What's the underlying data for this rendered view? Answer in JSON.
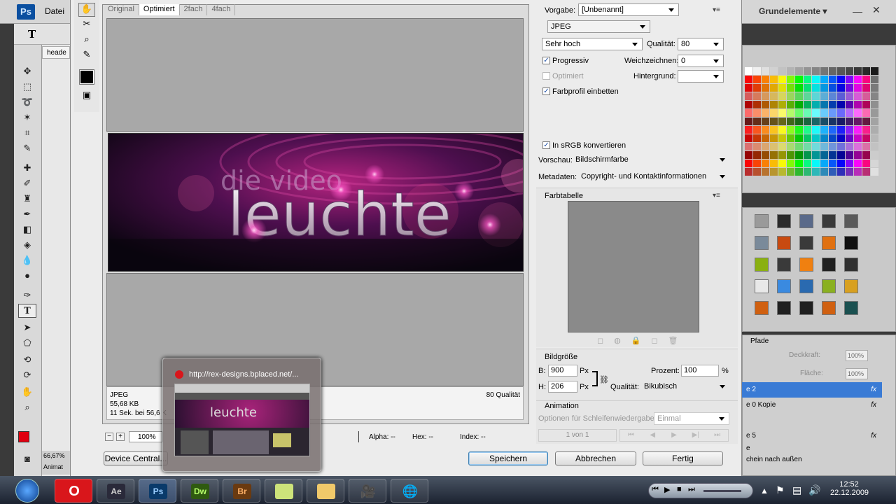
{
  "app": {
    "logo": "Ps",
    "menu_file": "Datei",
    "workspace": "Grundelemente"
  },
  "ps_tools": {
    "type_tool": "T",
    "doc_tab": "heade",
    "zoom_status": "66,67%",
    "anim_tab": "Animat"
  },
  "preview": {
    "tabs": [
      "Original",
      "Optimiert",
      "2fach",
      "4fach"
    ],
    "active_tab": "Optimiert",
    "banner_top_text": "die video",
    "banner_main_text": "leuchte",
    "info_format": "JPEG",
    "info_size": "55,68 KB",
    "info_time": "11 Sek. bei 56,6 K",
    "info_quality": "80 Qualität",
    "zoom": "100%",
    "alpha": "Alpha: --",
    "hex": "Hex: --",
    "index": "Index: --",
    "device_button": "Device Central..."
  },
  "settings": {
    "vorgabe_label": "Vorgabe:",
    "vorgabe_value": "[Unbenannt]",
    "format": "JPEG",
    "quality_preset": "Sehr hoch",
    "quality_label": "Qualität:",
    "quality_value": "80",
    "progressiv": "Progressiv",
    "weichzeichnen_label": "Weichzeichnen:",
    "weichzeichnen_value": "0",
    "optimiert": "Optimiert",
    "hintergrund_label": "Hintergrund:",
    "farbprofil": "Farbprofil einbetten",
    "srgb": "In sRGB konvertieren",
    "vorschau_label": "Vorschau:",
    "vorschau_value": "Bildschirmfarbe",
    "metadaten_label": "Metadaten:",
    "metadaten_value": "Copyright- und Kontaktinformationen",
    "farbtabelle": "Farbtabelle",
    "bildgroesse": "Bildgröße",
    "b_label": "B:",
    "b_value": "900",
    "h_label": "H:",
    "h_value": "206",
    "px": "Px",
    "prozent_label": "Prozent:",
    "prozent_value": "100",
    "percent": "%",
    "qualitaet_label": "Qualität:",
    "qualitaet_value": "Bikubisch",
    "animation": "Animation",
    "loop_label": "Optionen für Schleifenwiedergabe:",
    "loop_value": "Einmal",
    "frame": "1 von 1"
  },
  "buttons": {
    "save": "Speichern",
    "cancel": "Abbrechen",
    "done": "Fertig"
  },
  "layers": {
    "tab": "Pfade",
    "opacity_label": "Deckkraft:",
    "opacity": "100%",
    "fill_label": "Fläche:",
    "fill": "100%",
    "rows": [
      "e 2",
      "e 0 Kopie",
      "e 5",
      "e",
      "chein nach außen"
    ],
    "fx": "fx"
  },
  "thumbnail": {
    "url": "http://rex-designs.bplaced.net/..."
  },
  "taskbar": {
    "apps": [
      "Ae",
      "Ps",
      "Dw",
      "Br"
    ],
    "time": "12:52",
    "date": "22.12.2009"
  },
  "colors": {
    "accent": "#3c7fb1",
    "selected_layer": "#3a7bd5"
  }
}
